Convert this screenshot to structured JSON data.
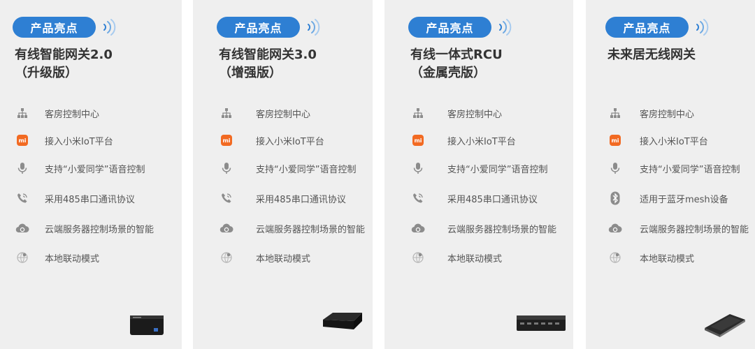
{
  "colors": {
    "accent": "#2e7fd3",
    "card_bg": "#efefef",
    "mi_orange": "#f26a22",
    "icon_gray": "#8c8c8c"
  },
  "cards": [
    {
      "badge": "产品亮点",
      "title_line1": "有线智能网关2.0",
      "title_line2": "（升级版）",
      "features": [
        {
          "icon": "org-chart-icon",
          "text": "客房控制中心"
        },
        {
          "icon": "mi-logo-icon",
          "text": "接入小米IoT平台"
        },
        {
          "icon": "microphone-icon",
          "text": "支持“小爱同学”语音控制"
        },
        {
          "icon": "phone-call-icon",
          "text": "采用485串口通讯协议"
        },
        {
          "icon": "cloud-icon",
          "text": "云端服务器控制场景的智能"
        },
        {
          "icon": "globe-icon",
          "text": "本地联动模式"
        }
      ],
      "device": "black-gateway-box"
    },
    {
      "badge": "产品亮点",
      "title_line1": "有线智能网关3.0",
      "title_line2": "（增强版）",
      "features": [
        {
          "icon": "org-chart-icon",
          "text": "客房控制中心"
        },
        {
          "icon": "mi-logo-icon",
          "text": "接入小米IoT平台"
        },
        {
          "icon": "microphone-icon",
          "text": "支持“小爱同学”语音控制"
        },
        {
          "icon": "phone-call-icon",
          "text": "采用485串口通讯协议"
        },
        {
          "icon": "cloud-icon",
          "text": "云端服务器控制场景的智能"
        },
        {
          "icon": "globe-icon",
          "text": "本地联动模式"
        }
      ],
      "device": "black-flat-gateway"
    },
    {
      "badge": "产品亮点",
      "title_line1": "有线一体式RCU",
      "title_line2": "（金属壳版）",
      "features": [
        {
          "icon": "org-chart-icon",
          "text": "客房控制中心"
        },
        {
          "icon": "mi-logo-icon",
          "text": "接入小米IoT平台"
        },
        {
          "icon": "microphone-icon",
          "text": "支持“小爱同学”语音控制"
        },
        {
          "icon": "phone-call-icon",
          "text": "采用485串口通讯协议"
        },
        {
          "icon": "cloud-icon",
          "text": "云端服务器控制场景的智能"
        },
        {
          "icon": "globe-icon",
          "text": "本地联动模式"
        }
      ],
      "device": "metal-rcu-box"
    },
    {
      "badge": "产品亮点",
      "title_line1": "未来居无线网关",
      "title_line2": "",
      "features": [
        {
          "icon": "org-chart-icon",
          "text": "客房控制中心"
        },
        {
          "icon": "mi-logo-icon",
          "text": "接入小米IoT平台"
        },
        {
          "icon": "microphone-icon",
          "text": "支持“小爱同学”语音控制"
        },
        {
          "icon": "bluetooth-icon",
          "text": "适用于蓝牙mesh设备"
        },
        {
          "icon": "cloud-icon",
          "text": "云端服务器控制场景的智能"
        },
        {
          "icon": "globe-icon",
          "text": "本地联动模式"
        }
      ],
      "device": "wireless-gateway-slab"
    }
  ]
}
